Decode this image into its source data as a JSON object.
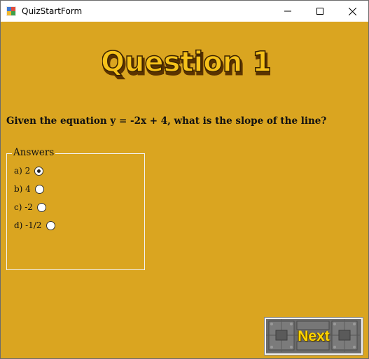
{
  "window": {
    "title": "QuizStartForm",
    "minimize_icon": "minimize-icon",
    "maximize_icon": "maximize-icon",
    "close_icon": "close-icon"
  },
  "header": {
    "title_art_text": "Question 1",
    "title_art_color": "#f6c21a"
  },
  "question": {
    "text": "Given the equation y = -2x + 4, what is the slope of the line?"
  },
  "answers": {
    "legend": "Answers",
    "options": [
      {
        "label": "a) 2",
        "selected": true
      },
      {
        "label": "b) 4",
        "selected": false
      },
      {
        "label": "c) -2",
        "selected": false
      },
      {
        "label": "d) -1/2",
        "selected": false
      }
    ]
  },
  "footer": {
    "next_label": "Next"
  },
  "colors": {
    "background": "#daa520",
    "titlebar": "#ffffff",
    "next_text": "#ffd400"
  }
}
